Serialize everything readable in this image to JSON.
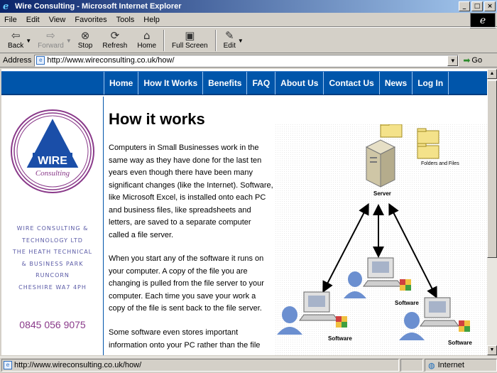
{
  "window": {
    "title": "Wire Consulting - Microsoft Internet Explorer"
  },
  "menu": [
    "File",
    "Edit",
    "View",
    "Favorites",
    "Tools",
    "Help"
  ],
  "toolbar": {
    "back": "Back",
    "forward": "Forward",
    "stop": "Stop",
    "refresh": "Refresh",
    "home": "Home",
    "fullscreen": "Full Screen",
    "edit": "Edit"
  },
  "address": {
    "label": "Address",
    "url": "http://www.wireconsulting.co.uk/how/",
    "go": "Go"
  },
  "site": {
    "nav": [
      "Home",
      "How It Works",
      "Benefits",
      "FAQ",
      "About Us",
      "Contact Us",
      "News",
      "Log In"
    ],
    "logo": {
      "name": "WIRE",
      "sub": "Consulting"
    },
    "company_address": [
      "WIRE CONSULTING &",
      "TECHNOLOGY LTD",
      "THE HEATH TECHNICAL",
      "& BUSINESS PARK",
      "RUNCORN",
      "CHESHIRE WA7 4PH"
    ],
    "phone": "0845 056 9075"
  },
  "main": {
    "heading": "How it works",
    "paragraphs": [
      "Computers in Small Businesses work in the same way as they have done for the last ten years even though there have been many significant changes (like the Internet). Software, like Microsoft Excel, is installed onto each PC and business files, like spreadsheets and letters, are saved to a separate computer called a file server.",
      "When you start any of the software it runs on your computer. A copy of the file you are changing is pulled from the file server to your computer. Each time you save your work a copy of the file is sent back to the file server.",
      "Some software even stores important information onto your PC rather than the file"
    ]
  },
  "diagram": {
    "folders_label": "Folders and Files",
    "server_label": "Server",
    "software_label": "Software"
  },
  "status": {
    "url": "http://www.wireconsulting.co.uk/how/",
    "zone": "Internet"
  }
}
